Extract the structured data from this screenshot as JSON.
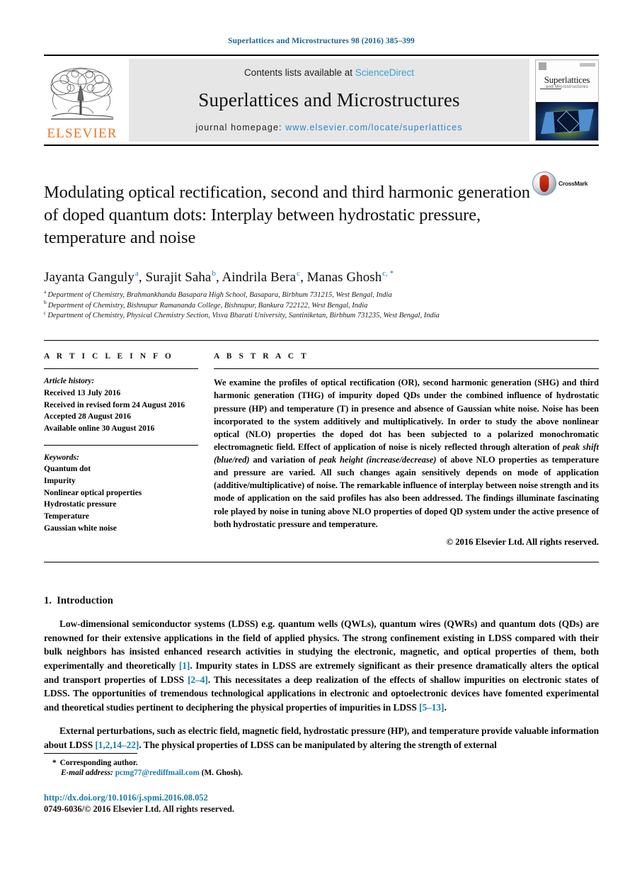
{
  "running_head": "Superlattices and Microstructures 98 (2016) 385–399",
  "masthead": {
    "publisher_logo_label": "ELSEVIER",
    "contents_prefix": "Contents lists available at ",
    "contents_link": "ScienceDirect",
    "journal_title": "Superlattices and Microstructures",
    "homepage_prefix": "journal homepage: ",
    "homepage_url": "www.elsevier.com/locate/superlattices",
    "cover": {
      "name": "Superlattices",
      "subtitle": "and Microstructures"
    }
  },
  "article": {
    "title": "Modulating optical rectification, second and third harmonic generation of doped quantum dots: Interplay between hydrostatic pressure, temperature and noise",
    "crossmark_label": "CrossMark",
    "authors": [
      {
        "name": "Jayanta Ganguly",
        "marks": "a",
        "sep": ", "
      },
      {
        "name": "Surajit Saha",
        "marks": "b",
        "sep": ", "
      },
      {
        "name": "Aindrila Bera",
        "marks": "c",
        "sep": ", "
      },
      {
        "name": "Manas Ghosh",
        "marks": "c, *",
        "sep": ""
      }
    ],
    "affiliations": [
      {
        "mark": "a",
        "text": "Department of Chemistry, Brahmankhanda Basapara High School, Basapara, Birbhum 731215, West Bengal, India"
      },
      {
        "mark": "b",
        "text": "Department of Chemistry, Bishnupur Ramananda College, Bishnupur, Bankura 722122, West Bengal, India"
      },
      {
        "mark": "c",
        "text": "Department of Chemistry, Physical Chemistry Section, Visva Bharati University, Santiniketan, Birbhum 731235, West Bengal, India"
      }
    ]
  },
  "article_info": {
    "heading": "A R T I C L E   I N F O",
    "history_label": "Article history:",
    "history": [
      "Received 13 July 2016",
      "Received in revised form 24 August 2016",
      "Accepted 28 August 2016",
      "Available online 30 August 2016"
    ],
    "keywords_label": "Keywords:",
    "keywords": [
      "Quantum dot",
      "Impurity",
      "Nonlinear optical properties",
      "Hydrostatic pressure",
      "Temperature",
      "Gaussian white noise"
    ]
  },
  "abstract": {
    "heading": "A B S T R A C T",
    "paragraph_part1": "We examine the profiles of optical rectification (OR), second harmonic generation (SHG) and third harmonic generation (THG) of impurity doped QDs under the combined influence of hydrostatic pressure (HP) and temperature (T) in presence and absence of Gaussian white noise. Noise has been incorporated to the system additively and multiplicatively. In order to study the above nonlinear optical (NLO) properties the doped dot has been subjected to a polarized monochromatic electromagnetic field. Effect of application of noise is nicely reflected through alteration of ",
    "italic1": "peak shift (blue/red)",
    "paragraph_part2": " and variation of ",
    "italic2": "peak height (increase/decrease)",
    "paragraph_part3": " of above NLO properties as temperature and pressure are varied. All such changes again sensitively depends on mode of application (additive/multiplicative) of noise. The remarkable influence of interplay between noise strength and its mode of application on the said profiles has also been addressed. The findings illuminate fascinating role played by noise in tuning above NLO properties of doped QD system under the active presence of both hydrostatic pressure and temperature.",
    "copyright": "© 2016 Elsevier Ltd. All rights reserved."
  },
  "introduction": {
    "number": "1.",
    "title": "Introduction",
    "para1_a": "Low-dimensional semiconductor systems (LDSS) e.g. quantum wells (QWLs), quantum wires (QWRs) and quantum dots (QDs) are renowned for their extensive applications in the field of applied physics. The strong confinement existing in LDSS compared with their bulk neighbors has insisted enhanced research activities in studying the electronic, magnetic, and optical properties of them, both experimentally and theoretically ",
    "ref1": "[1]",
    "para1_b": ". Impurity states in LDSS are extremely significant as their presence dramatically alters the optical and transport properties of LDSS ",
    "ref2": "[2–4]",
    "para1_c": ". This necessitates a deep realization of the effects of shallow impurities on electronic states of LDSS. The opportunities of tremendous technological applications in electronic and optoelectronic devices have fomented experimental and theoretical studies pertinent to deciphering the physical properties of impurities in LDSS ",
    "ref3": "[5–13]",
    "para1_d": ".",
    "para2_a": "External perturbations, such as electric field, magnetic field, hydrostatic pressure (HP), and temperature provide valuable information about LDSS ",
    "ref4": "[1,2,14–22]",
    "para2_b": ". The physical properties of LDSS can be manipulated by altering the strength of external"
  },
  "footer": {
    "corresponding_star": "*",
    "corresponding_text": "Corresponding author.",
    "email_label": "E-mail address:",
    "email": "pcmg77@rediffmail.com",
    "email_suffix": " (M. Ghosh).",
    "doi": "http://dx.doi.org/10.1016/j.spmi.2016.08.052",
    "issn_line": "0749-6036/© 2016 Elsevier Ltd. All rights reserved."
  },
  "colors": {
    "link_blue": "#1a7aad",
    "sciencedirect_blue": "#3d9fd4",
    "elsevier_orange": "#E87722"
  }
}
